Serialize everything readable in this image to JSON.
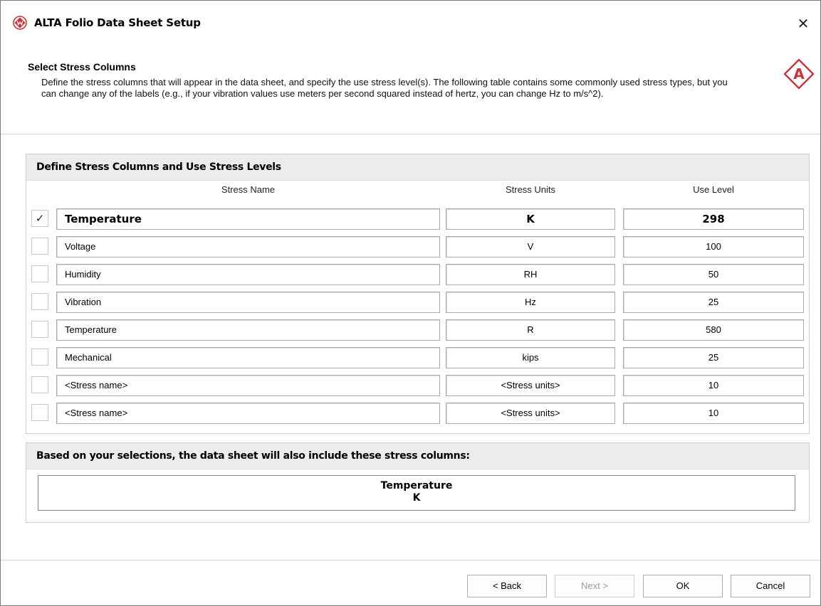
{
  "window": {
    "title": "ALTA Folio Data Sheet Setup",
    "close_glyph": "✕"
  },
  "header": {
    "title": "Select Stress Columns",
    "description": "Define the stress columns that will appear in the data sheet, and specify the use stress level(s). The following table contains some commonly used stress types, but you can change any of the labels (e.g., if your vibration values use meters per second squared instead of hertz, you can change Hz to m/s^2).",
    "badge_letter": "A"
  },
  "stress_group": {
    "title": "Define Stress Columns and Use Stress Levels",
    "columns": {
      "name": "Stress Name",
      "units": "Stress Units",
      "level": "Use Level"
    },
    "rows": [
      {
        "checked": true,
        "name": "Temperature",
        "units": "K",
        "level": "298"
      },
      {
        "checked": false,
        "name": "Voltage",
        "units": "V",
        "level": "100"
      },
      {
        "checked": false,
        "name": "Humidity",
        "units": "RH",
        "level": "50"
      },
      {
        "checked": false,
        "name": "Vibration",
        "units": "Hz",
        "level": "25"
      },
      {
        "checked": false,
        "name": "Temperature",
        "units": "R",
        "level": "580"
      },
      {
        "checked": false,
        "name": "Mechanical",
        "units": "kips",
        "level": "25"
      },
      {
        "checked": false,
        "name": "<Stress name>",
        "units": "<Stress units>",
        "level": "10"
      },
      {
        "checked": false,
        "name": "<Stress name>",
        "units": "<Stress units>",
        "level": "10"
      }
    ],
    "check_glyph": "✓"
  },
  "summary_group": {
    "title": "Based on your selections, the data sheet will also include these stress columns:",
    "stress_name": "Temperature",
    "stress_units": "K"
  },
  "buttons": {
    "back": "< Back",
    "next": "Next >",
    "ok": "OK",
    "cancel": "Cancel"
  },
  "colors": {
    "brand_red": "#c8343c",
    "panel_header_bg": "#ececec"
  }
}
